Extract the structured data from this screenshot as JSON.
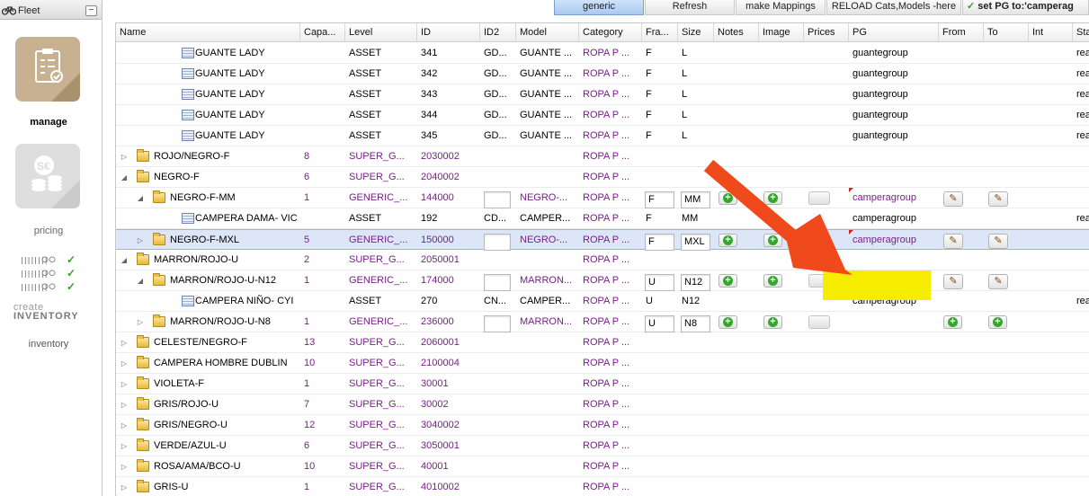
{
  "sidebar": {
    "title": "Fleet",
    "collapse": "−",
    "manage_label": "manage",
    "pricing_label": "pricing",
    "create_label": "create",
    "inventory_title": "INVENTORY",
    "inventory_label": "inventory"
  },
  "toolbar": {
    "generic": "generic",
    "refresh": "Refresh",
    "mappings": "make Mappings",
    "reload": "RELOAD Cats,Models -here",
    "setpg": "set PG to:'camperag"
  },
  "columns": [
    "Name",
    "Capa...",
    "Level",
    "ID",
    "ID2",
    "Model",
    "Category",
    "Fra...",
    "Size",
    "Notes",
    "Image",
    "Prices",
    "PG",
    "From",
    "To",
    "Int",
    "Sta"
  ],
  "rows": [
    {
      "kind": "asset",
      "indent": 3,
      "name": "GUANTE LADY",
      "cap": "",
      "level": "ASSET",
      "id": "341",
      "id2": "GD...",
      "model": "GUANTE ...",
      "cat": "ROPA P ...",
      "fra": "F",
      "size": "L",
      "pg": "guantegroup",
      "sta": "rea"
    },
    {
      "kind": "asset",
      "indent": 3,
      "name": "GUANTE LADY",
      "cap": "",
      "level": "ASSET",
      "id": "342",
      "id2": "GD...",
      "model": "GUANTE ...",
      "cat": "ROPA P ...",
      "fra": "F",
      "size": "L",
      "pg": "guantegroup",
      "sta": "rea"
    },
    {
      "kind": "asset",
      "indent": 3,
      "name": "GUANTE LADY",
      "cap": "",
      "level": "ASSET",
      "id": "343",
      "id2": "GD...",
      "model": "GUANTE ...",
      "cat": "ROPA P ...",
      "fra": "F",
      "size": "L",
      "pg": "guantegroup",
      "sta": "rea"
    },
    {
      "kind": "asset",
      "indent": 3,
      "name": "GUANTE LADY",
      "cap": "",
      "level": "ASSET",
      "id": "344",
      "id2": "GD...",
      "model": "GUANTE ...",
      "cat": "ROPA P ...",
      "fra": "F",
      "size": "L",
      "pg": "guantegroup",
      "sta": "rea"
    },
    {
      "kind": "asset",
      "indent": 3,
      "name": "GUANTE LADY",
      "cap": "",
      "level": "ASSET",
      "id": "345",
      "id2": "GD...",
      "model": "GUANTE ...",
      "cat": "ROPA P ...",
      "fra": "F",
      "size": "L",
      "pg": "guantegroup",
      "sta": "rea"
    },
    {
      "kind": "folder",
      "toggle": "▷",
      "indent": 1,
      "name": "ROJO/NEGRO-F",
      "cap": "8",
      "level": "SUPER_G...",
      "id": "2030002",
      "cat": "ROPA P ..."
    },
    {
      "kind": "folder",
      "toggle": "◢",
      "indent": 1,
      "name": "NEGRO-F",
      "cap": "6",
      "level": "SUPER_G...",
      "id": "2040002",
      "cat": "ROPA P ..."
    },
    {
      "kind": "generic",
      "toggle": "◢",
      "indent": 2,
      "name": "NEGRO-F-MM",
      "cap": "1",
      "level": "GENERIC_...",
      "id": "144000",
      "model": "NEGRO-...",
      "cat": "ROPA P ...",
      "fra": "F",
      "size": "MM",
      "pg": "camperagroup",
      "edit": true
    },
    {
      "kind": "asset",
      "indent": 3,
      "name": "CAMPERA DAMA- VIC",
      "cap": "",
      "level": "ASSET",
      "id": "192",
      "id2": "CD...",
      "model": "CAMPER...",
      "cat": "ROPA P ...",
      "fra": "F",
      "size": "MM",
      "pg": "camperagroup",
      "sta": "rea"
    },
    {
      "kind": "generic",
      "toggle": "▷",
      "indent": 2,
      "name": "NEGRO-F-MXL",
      "cap": "5",
      "level": "GENERIC_...",
      "id": "150000",
      "model": "NEGRO-...",
      "cat": "ROPA P ...",
      "fra": "F",
      "size": "MXL",
      "pg": "camperagroup",
      "edit": true,
      "sel": true
    },
    {
      "kind": "folder",
      "toggle": "◢",
      "indent": 1,
      "name": "MARRON/ROJO-U",
      "cap": "2",
      "level": "SUPER_G...",
      "id": "2050001",
      "cat": "ROPA P ..."
    },
    {
      "kind": "generic",
      "toggle": "◢",
      "indent": 2,
      "name": "MARRON/ROJO-U-N12",
      "cap": "1",
      "level": "GENERIC_...",
      "id": "174000",
      "model": "MARRON...",
      "cat": "ROPA P ...",
      "fra": "U",
      "size": "N12",
      "pg": "missing",
      "edit": true
    },
    {
      "kind": "asset",
      "indent": 3,
      "name": "CAMPERA NIÑO- CYI",
      "cap": "",
      "level": "ASSET",
      "id": "270",
      "id2": "CN...",
      "model": "CAMPER...",
      "cat": "ROPA P ...",
      "fra": "U",
      "size": "N12",
      "pg": "camperagroup",
      "sta": "rea"
    },
    {
      "kind": "generic",
      "toggle": "▷",
      "indent": 2,
      "name": "MARRON/ROJO-U-N8",
      "cap": "1",
      "level": "GENERIC_...",
      "id": "236000",
      "model": "MARRON...",
      "cat": "ROPA P ...",
      "fra": "U",
      "size": "N8",
      "pg": "",
      "plusFromTo": true
    },
    {
      "kind": "folder",
      "toggle": "▷",
      "indent": 1,
      "name": "CELESTE/NEGRO-F",
      "cap": "13",
      "level": "SUPER_G...",
      "id": "2060001",
      "cat": "ROPA P ..."
    },
    {
      "kind": "folder",
      "toggle": "▷",
      "indent": 1,
      "name": "CAMPERA HOMBRE DUBLIN",
      "cap": "10",
      "level": "SUPER_G...",
      "id": "2100004",
      "cat": "ROPA P ..."
    },
    {
      "kind": "folder",
      "toggle": "▷",
      "indent": 1,
      "name": "VIOLETA-F",
      "cap": "1",
      "level": "SUPER_G...",
      "id": "30001",
      "cat": "ROPA P ..."
    },
    {
      "kind": "folder",
      "toggle": "▷",
      "indent": 1,
      "name": "GRIS/ROJO-U",
      "cap": "7",
      "level": "SUPER_G...",
      "id": "30002",
      "cat": "ROPA P ..."
    },
    {
      "kind": "folder",
      "toggle": "▷",
      "indent": 1,
      "name": "GRIS/NEGRO-U",
      "cap": "12",
      "level": "SUPER_G...",
      "id": "3040002",
      "cat": "ROPA P ..."
    },
    {
      "kind": "folder",
      "toggle": "▷",
      "indent": 1,
      "name": "VERDE/AZUL-U",
      "cap": "6",
      "level": "SUPER_G...",
      "id": "3050001",
      "cat": "ROPA P ..."
    },
    {
      "kind": "folder",
      "toggle": "▷",
      "indent": 1,
      "name": "ROSA/AMA/BCO-U",
      "cap": "10",
      "level": "SUPER_G...",
      "id": "40001",
      "cat": "ROPA P ..."
    },
    {
      "kind": "folder",
      "toggle": "▷",
      "indent": 1,
      "name": "GRIS-U",
      "cap": "1",
      "level": "SUPER_G...",
      "id": "4010002",
      "cat": "ROPA P ..."
    }
  ]
}
